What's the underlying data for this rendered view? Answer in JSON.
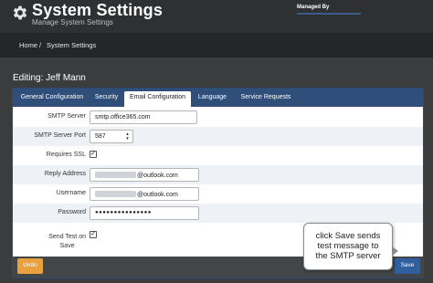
{
  "header": {
    "title": "System Settings",
    "subtitle": "Manage System Settings",
    "managed_by_label": "Managed By",
    "icon": "gear-icon"
  },
  "breadcrumb": {
    "home": "Home",
    "separator": "/",
    "current": "System Settings"
  },
  "editing_label": "Editing:  Jeff Mann",
  "tabs": [
    {
      "label": "General Configuration",
      "active": false
    },
    {
      "label": "Security",
      "active": false
    },
    {
      "label": "Email Configuration",
      "active": true
    },
    {
      "label": "Language",
      "active": false
    },
    {
      "label": "Service Requests",
      "active": false
    }
  ],
  "form": {
    "smtp_server": {
      "label": "SMTP Server",
      "value": "smtp.office365.com"
    },
    "smtp_port": {
      "label": "SMTP Server Port",
      "value": "587"
    },
    "requires_ssl": {
      "label": "Requires SSL",
      "checked": true
    },
    "reply_address": {
      "label": "Reply Address",
      "value": "@outlook.com"
    },
    "username": {
      "label": "Username",
      "value": "@outlook.com"
    },
    "password": {
      "label": "Password",
      "value": "●●●●●●●●●●●●●●●"
    },
    "send_test": {
      "label_line1": "Send Test on",
      "label_line2": "Save",
      "checked": true
    }
  },
  "buttons": {
    "undo": "Undo",
    "save": "Save"
  },
  "callout": {
    "line1": "click Save sends",
    "line2": "test message to",
    "line3": "the SMTP server"
  },
  "colors": {
    "tab_bar": "#2f4e79",
    "undo": "#e8a13e",
    "save": "#2f5f9e"
  }
}
